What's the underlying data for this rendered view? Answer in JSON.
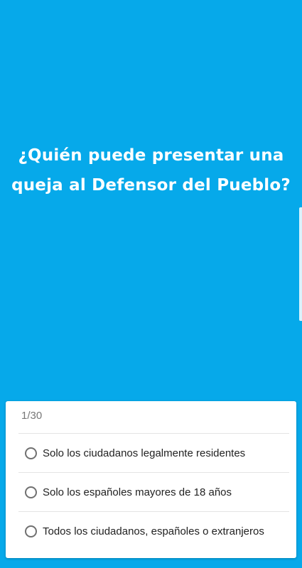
{
  "question": {
    "line1": "¿Quién puede presentar una",
    "line2": "queja al Defensor del Pueblo?"
  },
  "quiz": {
    "counter": "1/30",
    "options": [
      {
        "label": "Solo los ciudadanos legalmente residentes"
      },
      {
        "label": "Solo los españoles mayores de 18 años"
      },
      {
        "label": "Todos los ciudadanos, españoles o extranjeros"
      }
    ]
  },
  "colors": {
    "background": "#06a9ea",
    "card": "#ffffff",
    "text": "#222222"
  }
}
